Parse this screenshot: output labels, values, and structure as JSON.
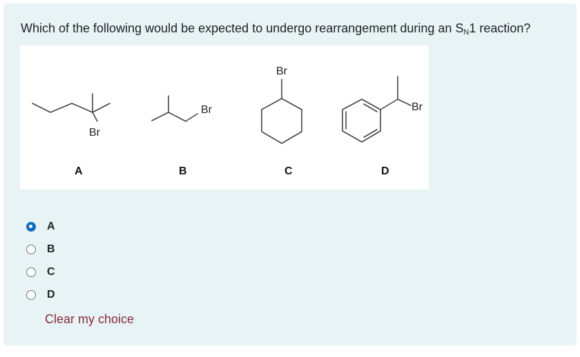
{
  "question": {
    "text_before": "Which of the following would be expected to undergo rearrangement during an S",
    "subscript": "N",
    "text_after": "1 reaction?"
  },
  "figure": {
    "molecules": [
      {
        "tag": "A",
        "atom_label": "Br"
      },
      {
        "tag": "B",
        "atom_label": "Br"
      },
      {
        "tag": "C",
        "atom_label": "Br"
      },
      {
        "tag": "D",
        "atom_label": "Br"
      }
    ]
  },
  "options": [
    {
      "label": "A",
      "selected": true
    },
    {
      "label": "B",
      "selected": false
    },
    {
      "label": "C",
      "selected": false
    },
    {
      "label": "D",
      "selected": false
    }
  ],
  "clear_label": "Clear my choice",
  "colors": {
    "card_bg": "#e7f3f5",
    "radio_selected": "#0f6cbf",
    "clear_link": "#8a2a3a"
  }
}
